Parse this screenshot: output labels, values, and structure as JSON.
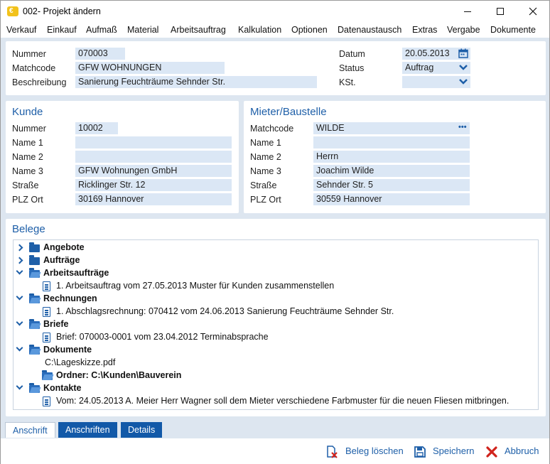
{
  "window": {
    "title": "002- Projekt ändern",
    "app_icon_glyph": "€"
  },
  "menu": [
    "Verkauf",
    "Einkauf",
    "Aufmaß",
    "Material",
    "Arbeitsauftrag",
    "Kalkulation",
    "Optionen",
    "Datenaustausch",
    "Extras",
    "Vergabe",
    "Dokumente"
  ],
  "header": {
    "nummer_label": "Nummer",
    "nummer_value": "070003",
    "matchcode_label": "Matchcode",
    "matchcode_value": "GFW WOHNUNGEN",
    "beschreibung_label": "Beschreibung",
    "beschreibung_value": "Sanierung Feuchträume Sehnder Str.",
    "datum_label": "Datum",
    "datum_value": "20.05.2013",
    "status_label": "Status",
    "status_value": "Auftrag",
    "kst_label": "KSt.",
    "kst_value": ""
  },
  "kunde": {
    "title": "Kunde",
    "nummer_label": "Nummer",
    "nummer_value": "10002",
    "name1_label": "Name 1",
    "name1_value": "",
    "name2_label": "Name 2",
    "name2_value": "",
    "name3_label": "Name 3",
    "name3_value": "GFW Wohnungen GmbH",
    "strasse_label": "Straße",
    "strasse_value": "Ricklinger Str. 12",
    "plzort_label": "PLZ Ort",
    "plzort_value": "30169 Hannover"
  },
  "mieter": {
    "title": "Mieter/Baustelle",
    "matchcode_label": "Matchcode",
    "matchcode_value": "WILDE",
    "name1_label": "Name 1",
    "name1_value": "",
    "name2_label": "Name 2",
    "name2_value": "Herrn",
    "name3_label": "Name 3",
    "name3_value": "Joachim Wilde",
    "strasse_label": "Straße",
    "strasse_value": "Sehnder Str. 5",
    "plzort_label": "PLZ Ort",
    "plzort_value": "30559 Hannover",
    "more_glyph": "•••"
  },
  "belege": {
    "title": "Belege",
    "tree": [
      {
        "label": "Angebote"
      },
      {
        "label": "Aufträge"
      },
      {
        "label": "Arbeitsaufträge"
      },
      {
        "label": "1. Arbeitsauftrag vom 27.05.2013 Muster für Kunden zusammenstellen"
      },
      {
        "label": "Rechnungen"
      },
      {
        "label": "1. Abschlagsrechnung: 070412 vom 24.06.2013 Sanierung Feuchträume Sehnder Str."
      },
      {
        "label": "Briefe"
      },
      {
        "label": "Brief: 070003-0001 vom 23.04.2012 Terminabsprache"
      },
      {
        "label": "Dokumente"
      },
      {
        "label": "C:\\Lageskizze.pdf"
      },
      {
        "label": "Ordner: C:\\Kunden\\Bauverein"
      },
      {
        "label": "Kontakte"
      },
      {
        "label": "Vom: 24.05.2013 A. Meier Herr Wagner soll dem Mieter verschiedene Farbmuster für die neuen Fliesen mitbringen."
      }
    ]
  },
  "tabs": [
    "Anschrift",
    "Anschriften",
    "Details"
  ],
  "footer": {
    "delete_label": "Beleg löschen",
    "save_label": "Speichern",
    "cancel_label": "Abbruch"
  },
  "icons": [
    "calendar-icon",
    "chevron-down-icon",
    "ellipsis-icon",
    "folder-icon",
    "document-icon",
    "delete-document-icon",
    "save-icon",
    "close-icon"
  ],
  "colors": {
    "accent": "#1e5fa8",
    "field_bg": "#dbe7f5",
    "panel_bg": "#dde6f0",
    "tab_inactive": "#1259a8",
    "cancel_red": "#d0231c"
  }
}
